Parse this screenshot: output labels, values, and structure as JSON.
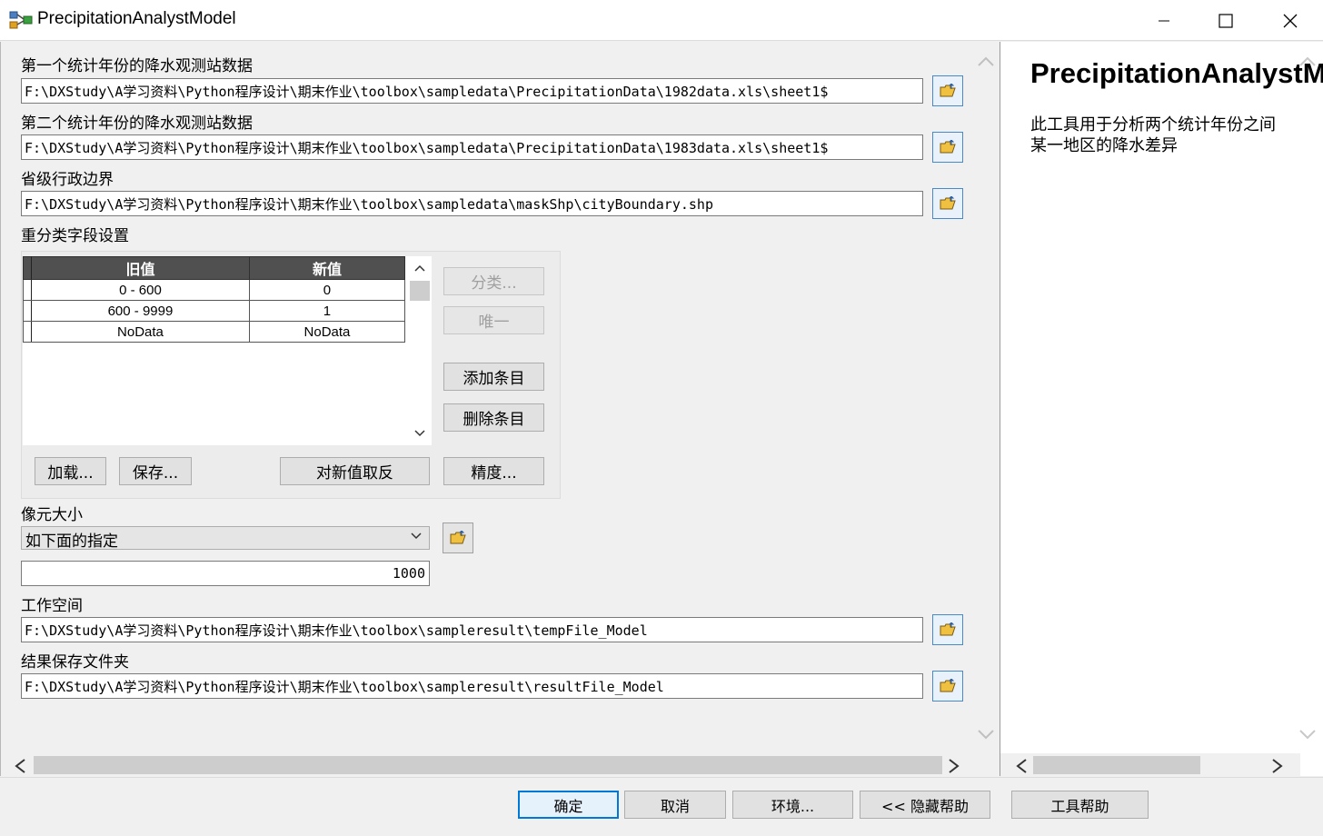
{
  "window": {
    "title": "PrecipitationAnalystModel"
  },
  "fields": {
    "year1": {
      "label": "第一个统计年份的降水观测站数据",
      "value": "F:\\DXStudy\\A学习资料\\Python程序设计\\期末作业\\toolbox\\sampledata\\PrecipitationData\\1982data.xls\\sheet1$"
    },
    "year2": {
      "label": "第二个统计年份的降水观测站数据",
      "value": "F:\\DXStudy\\A学习资料\\Python程序设计\\期末作业\\toolbox\\sampledata\\PrecipitationData\\1983data.xls\\sheet1$"
    },
    "boundary": {
      "label": "省级行政边界",
      "value": "F:\\DXStudy\\A学习资料\\Python程序设计\\期末作业\\toolbox\\sampledata\\maskShp\\cityBoundary.shp"
    },
    "reclass": {
      "label": "重分类字段设置",
      "columns": [
        "旧值",
        "新值"
      ],
      "rows": [
        {
          "old": "0 - 600",
          "new": "0"
        },
        {
          "old": "600 - 9999",
          "new": "1"
        },
        {
          "old": "NoData",
          "new": "NoData"
        }
      ],
      "buttons": {
        "classify": "分类...",
        "unique": "唯一",
        "add": "添加条目",
        "delete": "删除条目",
        "load": "加载...",
        "save": "保存...",
        "reverse": "对新值取反",
        "precision": "精度..."
      }
    },
    "cellsize": {
      "label": "像元大小",
      "selected": "如下面的指定",
      "value": "1000"
    },
    "workspace": {
      "label": "工作空间",
      "value": "F:\\DXStudy\\A学习资料\\Python程序设计\\期末作业\\toolbox\\sampleresult\\tempFile_Model"
    },
    "output": {
      "label": "结果保存文件夹",
      "value": "F:\\DXStudy\\A学习资料\\Python程序设计\\期末作业\\toolbox\\sampleresult\\resultFile_Model"
    }
  },
  "help": {
    "title": "PrecipitationAnalystModel",
    "description": "此工具用于分析两个统计年份之间某一地区的降水差异"
  },
  "bottom": {
    "ok": "确定",
    "cancel": "取消",
    "env": "环境...",
    "hide_help": "<< 隐藏帮助",
    "tool_help": "工具帮助"
  },
  "icons": {
    "app": "model-icon",
    "browse": "open-folder-icon"
  },
  "colors": {
    "accent": "#0078d7",
    "folder": "#f0c040"
  }
}
